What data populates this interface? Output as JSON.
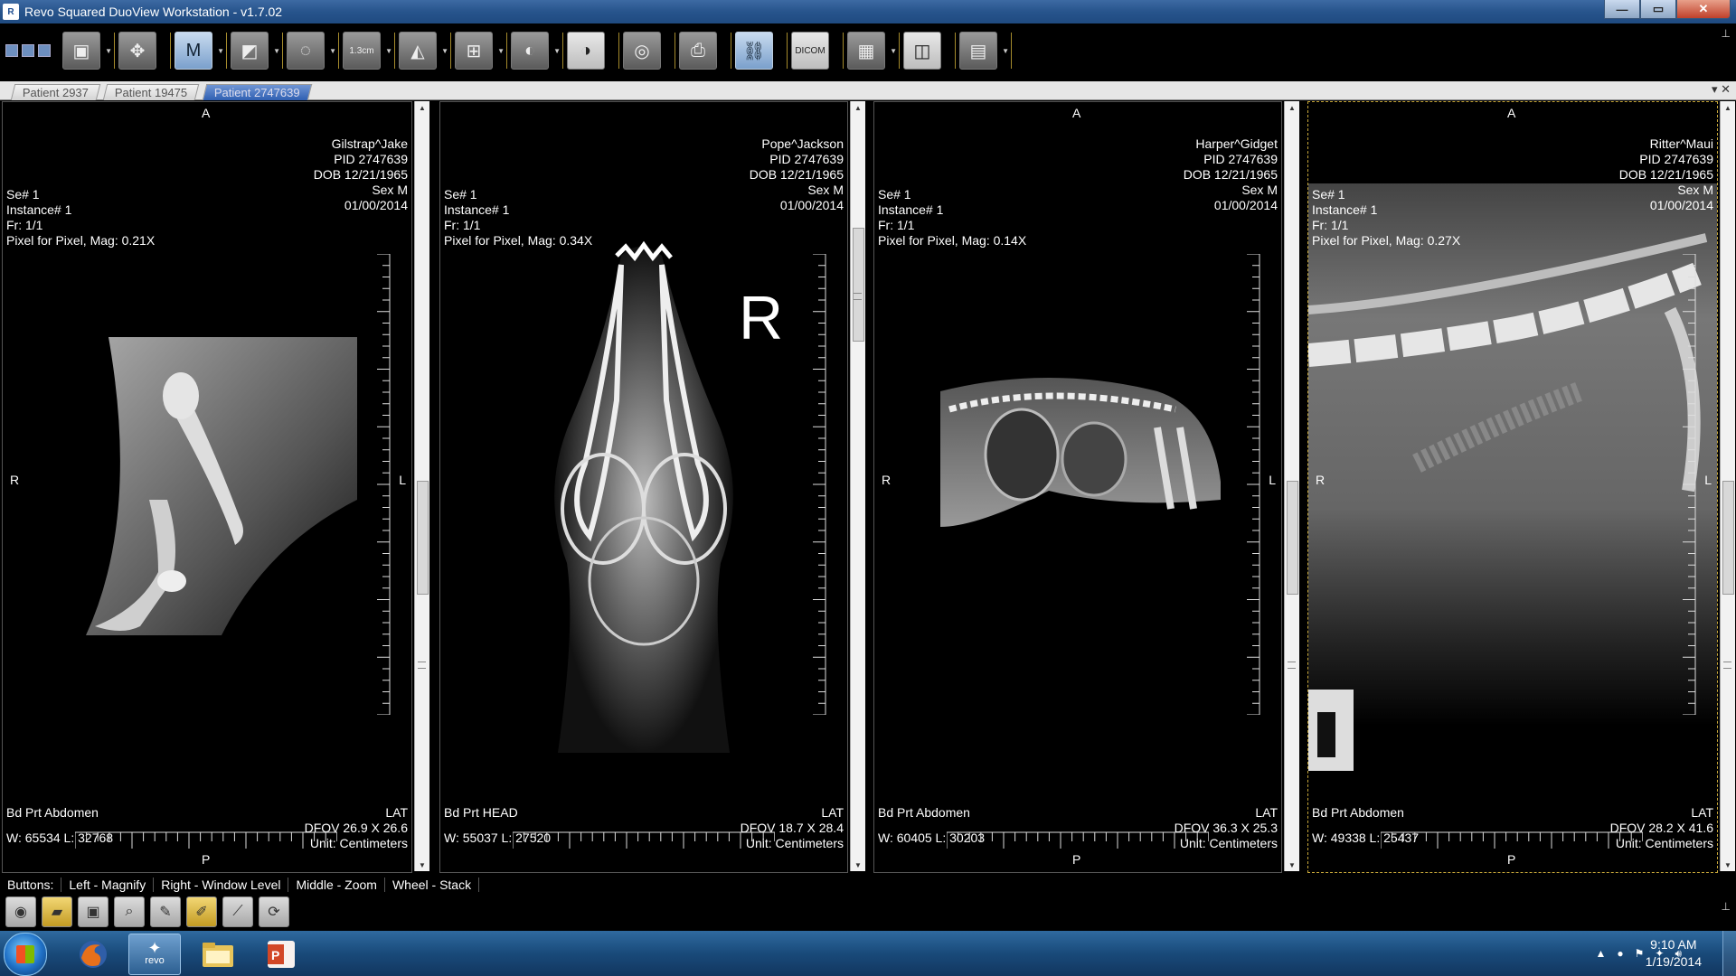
{
  "window": {
    "title": "Revo Squared DuoView Workstation - v1.7.02",
    "minimize": "—",
    "maximize": "▭",
    "close": "✕"
  },
  "toolbar": {
    "tools": [
      {
        "id": "archive",
        "label": "▣",
        "dropdown": true
      },
      {
        "id": "pan",
        "label": "✥",
        "dropdown": false
      },
      {
        "id": "magnify",
        "label": "M",
        "dropdown": true,
        "active": true
      },
      {
        "id": "window-level",
        "label": "◩",
        "dropdown": true
      },
      {
        "id": "roi",
        "label": "◌",
        "dropdown": true
      },
      {
        "id": "measure",
        "label": "1.3cm",
        "dropdown": true
      },
      {
        "id": "angle",
        "label": "◭",
        "dropdown": true
      },
      {
        "id": "layout",
        "label": "⊞",
        "dropdown": true
      },
      {
        "id": "rotate",
        "label": "◐",
        "dropdown": true
      },
      {
        "id": "invert",
        "label": "◑",
        "dropdown": false
      },
      {
        "id": "cine",
        "label": "◎",
        "dropdown": false
      },
      {
        "id": "print",
        "label": "⎙",
        "dropdown": false
      },
      {
        "id": "link",
        "label": "⛓",
        "dropdown": false,
        "active": true
      },
      {
        "id": "dicom-info",
        "label": "DICOM",
        "dropdown": false
      },
      {
        "id": "series-layout",
        "label": "▦",
        "dropdown": true
      },
      {
        "id": "export",
        "label": "◫",
        "dropdown": false
      },
      {
        "id": "film",
        "label": "▤",
        "dropdown": true
      }
    ]
  },
  "tabs": [
    {
      "label": "Patient 2937",
      "active": false
    },
    {
      "label": "Patient 19475",
      "active": false
    },
    {
      "label": "Patient 2747639",
      "active": true
    }
  ],
  "tab_controls": "▾ ✕",
  "viewports": [
    {
      "top_label": "A",
      "bottom_label": "P",
      "left_label": "R",
      "right_label": "L",
      "name": "Gilstrap^Jake",
      "pid": "PID 2747639",
      "dob": "DOB 12/21/1965",
      "sex": "Sex M",
      "date": "01/00/2014",
      "series": "Se# 1",
      "instance": "Instance# 1",
      "frame": "Fr: 1/1",
      "mag": "Pixel for Pixel, Mag: 0.21X",
      "body_part": "Bd Prt Abdomen",
      "view": "LAT",
      "dfov": "DFOV 26.9 X 26.6",
      "wl": "W: 65534 L: 32768",
      "unit": "Unit:  Centimeters"
    },
    {
      "top_label": "",
      "bottom_label": "",
      "left_label": "",
      "right_label": "",
      "marker": "R",
      "name": "Pope^Jackson",
      "pid": "PID 2747639",
      "dob": "DOB 12/21/1965",
      "sex": "Sex M",
      "date": "01/00/2014",
      "series": "Se# 1",
      "instance": "Instance# 1",
      "frame": "Fr: 1/1",
      "mag": "Pixel for Pixel, Mag: 0.34X",
      "body_part": "Bd Prt HEAD",
      "view": "LAT",
      "dfov": "DFOV 18.7 X 28.4",
      "wl": "W: 55037 L: 27520",
      "unit": "Unit:  Centimeters"
    },
    {
      "top_label": "A",
      "bottom_label": "P",
      "left_label": "R",
      "right_label": "L",
      "name": "Harper^Gidget",
      "pid": "PID 2747639",
      "dob": "DOB 12/21/1965",
      "sex": "Sex M",
      "date": "01/00/2014",
      "series": "Se# 1",
      "instance": "Instance# 1",
      "frame": "Fr: 1/1",
      "mag": "Pixel for Pixel, Mag: 0.14X",
      "body_part": "Bd Prt Abdomen",
      "view": "LAT",
      "dfov": "DFOV 36.3 X 25.3",
      "wl": "W: 60405 L: 30203",
      "unit": "Unit:  Centimeters"
    },
    {
      "top_label": "A",
      "bottom_label": "P",
      "left_label": "R",
      "right_label": "L",
      "name": "Ritter^Maui",
      "pid": "PID 2747639",
      "dob": "DOB 12/21/1965",
      "sex": "Sex M",
      "date": "01/00/2014",
      "series": "Se# 1",
      "instance": "Instance# 1",
      "frame": "Fr: 1/1",
      "mag": "Pixel for Pixel, Mag: 0.27X",
      "body_part": "Bd Prt Abdomen",
      "view": "LAT",
      "dfov": "DFOV 28.2 X 41.6",
      "wl": "W: 49338 L: 25437",
      "unit": "Unit:  Centimeters"
    }
  ],
  "mouse_buttons": [
    "Buttons:",
    "Left -  Magnify",
    "Right -  Window Level",
    "Middle -  Zoom",
    "Wheel -  Stack"
  ],
  "bottom_tools": [
    "◉",
    "▰",
    "▣",
    "⌕",
    "✎",
    "✐",
    "⟋",
    "⟳"
  ],
  "taskbar": {
    "apps": [
      "firefox",
      "revo",
      "explorer",
      "powerpoint"
    ],
    "revo_label": "revo",
    "time": "9:10 AM",
    "date": "1/19/2014"
  }
}
